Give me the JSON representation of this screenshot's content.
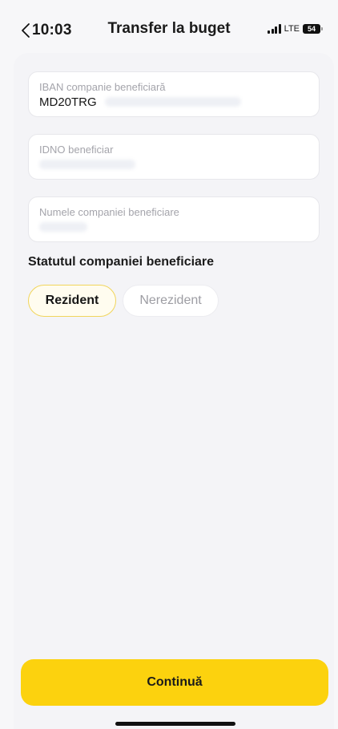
{
  "status_bar": {
    "time": "10:03",
    "network": "LTE",
    "battery": "54"
  },
  "header": {
    "title": "Transfer la buget",
    "back_icon": "chevron-left-icon"
  },
  "form": {
    "iban": {
      "label": "IBAN companie beneficiară",
      "value": "MD20TRG"
    },
    "idno": {
      "label": "IDNO beneficiar",
      "value": ""
    },
    "company_name": {
      "label": "Numele companiei beneficiare",
      "value": ""
    }
  },
  "status_section": {
    "title": "Statutul companiei beneficiare",
    "options": [
      {
        "label": "Rezident",
        "selected": true
      },
      {
        "label": "Nerezident",
        "selected": false
      }
    ]
  },
  "actions": {
    "continue_label": "Continuă"
  },
  "colors": {
    "accent": "#FCD20E",
    "selected_border": "#F1D55C",
    "background": "#F7F7F9"
  }
}
